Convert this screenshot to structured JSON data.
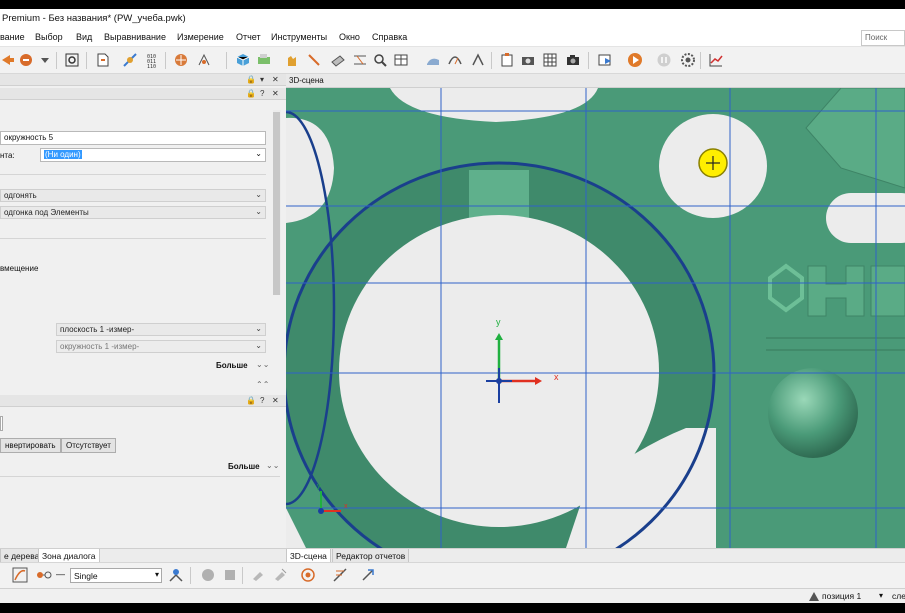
{
  "window": {
    "title": "Premium - Без названия* (PW_учеба.pwk)"
  },
  "menu": {
    "items": [
      "вание",
      "Выбор",
      "Вид",
      "Выравнивание",
      "Измерение",
      "Отчет",
      "Инструменты",
      "Окно",
      "Справка"
    ],
    "search_placeholder": "Поиск"
  },
  "left_panel": {
    "field_name": "окружность 5",
    "label_element": "нта:",
    "element_value": "(Ни один)",
    "fit_label": "одгонять",
    "fit_mode": "одгонка под Элементы",
    "offset_label": "вмещение",
    "plane_combo": "плоскость 1 -измер-",
    "circle_combo": "окружность 1 -измер-",
    "more_label_1": "Больше",
    "invert_button": "нвертировать",
    "absent_button": "Отсутствует",
    "more_label_2": "Больше"
  },
  "scene": {
    "title": "3D-сцена",
    "axis_x": "x",
    "axis_y": "y"
  },
  "tabs": {
    "left": [
      "е дерева",
      "Зона диалога"
    ],
    "right": [
      "3D-сцена",
      "Редактор отчетов"
    ]
  },
  "bottom_toolbar": {
    "mode_select": "Single"
  },
  "status": {
    "position": "позиция 1",
    "right_text": "сле"
  },
  "colors": {
    "mesh": "#4a9a78",
    "mesh_highlight": "#6dbf97",
    "hole_fill": "#ececec",
    "grid_line": "#2f62c9",
    "selected_circle": "#1a3f8c",
    "axis_x": "#e03020",
    "axis_y": "#20b040",
    "axis_z": "#1a3fa0",
    "marker": "#ffee00"
  }
}
